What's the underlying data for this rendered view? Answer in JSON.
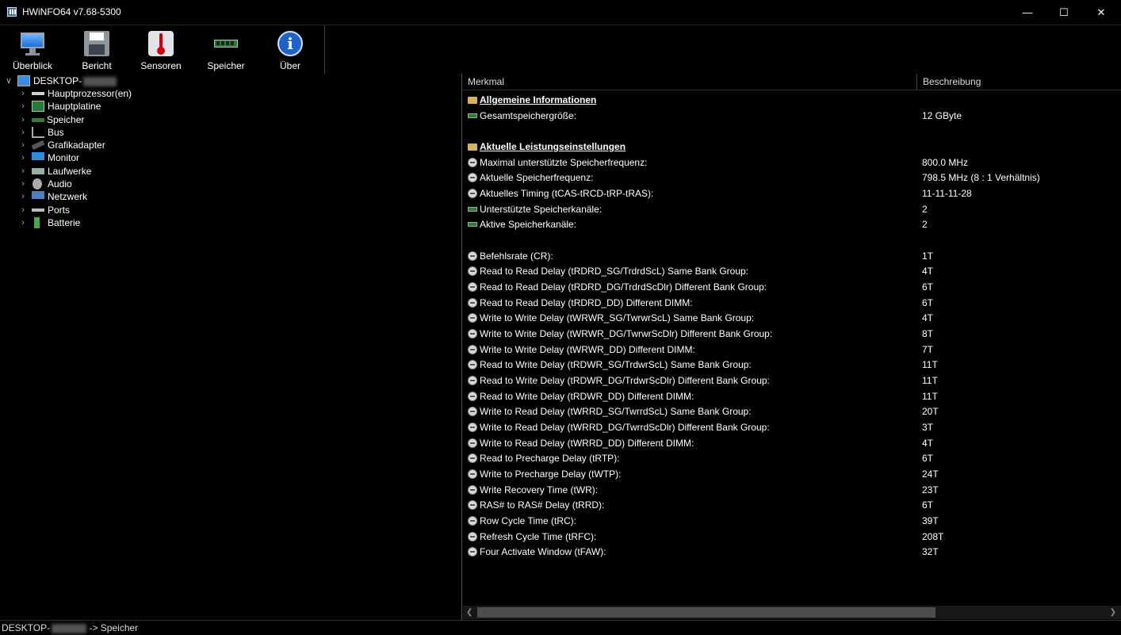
{
  "window": {
    "title": "HWiNFO64 v7.68-5300"
  },
  "toolbar": [
    {
      "label": "Überblick",
      "icon": "monitor-icon"
    },
    {
      "label": "Bericht",
      "icon": "floppy-disk-icon"
    },
    {
      "label": "Sensoren",
      "icon": "thermometer-icon"
    },
    {
      "label": "Speicher",
      "icon": "memory-module-icon"
    },
    {
      "label": "Über",
      "icon": "info-icon"
    }
  ],
  "tree": {
    "root": "DESKTOP-",
    "items": [
      {
        "label": "Hauptprozessor(en)",
        "icon": "cpu-icon"
      },
      {
        "label": "Hauptplatine",
        "icon": "motherboard-icon"
      },
      {
        "label": "Speicher",
        "icon": "memory-icon",
        "selected": true
      },
      {
        "label": "Bus",
        "icon": "bus-icon"
      },
      {
        "label": "Grafikadapter",
        "icon": "gpu-icon"
      },
      {
        "label": "Monitor",
        "icon": "monitor-icon"
      },
      {
        "label": "Laufwerke",
        "icon": "drive-icon"
      },
      {
        "label": "Audio",
        "icon": "audio-icon"
      },
      {
        "label": "Netzwerk",
        "icon": "network-icon"
      },
      {
        "label": "Ports",
        "icon": "ports-icon"
      },
      {
        "label": "Batterie",
        "icon": "battery-icon"
      }
    ]
  },
  "details": {
    "columns": {
      "merkmal": "Merkmal",
      "beschreibung": "Beschreibung"
    },
    "rows": [
      {
        "type": "section",
        "label": "Allgemeine Informationen",
        "value": ""
      },
      {
        "type": "ram",
        "label": "Gesamtspeichergröße:",
        "value": "12 GByte"
      },
      {
        "type": "section",
        "label": "Aktuelle Leistungseinstellungen",
        "value": ""
      },
      {
        "type": "circle",
        "label": "Maximal unterstützte Speicherfrequenz:",
        "value": "800.0 MHz"
      },
      {
        "type": "circle",
        "label": "Aktuelle Speicherfrequenz:",
        "value": "798.5 MHz (8 : 1 Verhältnis)"
      },
      {
        "type": "circle",
        "label": "Aktuelles Timing (tCAS-tRCD-tRP-tRAS):",
        "value": "11-11-11-28"
      },
      {
        "type": "ram",
        "label": "Unterstützte Speicherkanäle:",
        "value": "2"
      },
      {
        "type": "ram",
        "label": "Aktive Speicherkanäle:",
        "value": "2"
      },
      {
        "type": "circle",
        "label": "Befehlsrate (CR):",
        "value": "1T"
      },
      {
        "type": "circle",
        "label": "Read to Read Delay (tRDRD_SG/TrdrdScL) Same Bank Group:",
        "value": "4T"
      },
      {
        "type": "circle",
        "label": "Read to Read Delay (tRDRD_DG/TrdrdScDlr) Different Bank Group:",
        "value": "6T"
      },
      {
        "type": "circle",
        "label": "Read to Read Delay (tRDRD_DD) Different DIMM:",
        "value": "6T"
      },
      {
        "type": "circle",
        "label": "Write to Write Delay (tWRWR_SG/TwrwrScL) Same Bank Group:",
        "value": "4T"
      },
      {
        "type": "circle",
        "label": "Write to Write Delay (tWRWR_DG/TwrwrScDlr) Different Bank Group:",
        "value": "8T"
      },
      {
        "type": "circle",
        "label": "Write to Write Delay (tWRWR_DD) Different DIMM:",
        "value": "7T"
      },
      {
        "type": "circle",
        "label": "Read to Write Delay (tRDWR_SG/TrdwrScL) Same Bank Group:",
        "value": "11T"
      },
      {
        "type": "circle",
        "label": "Read to Write Delay (tRDWR_DG/TrdwrScDlr) Different Bank Group:",
        "value": "11T"
      },
      {
        "type": "circle",
        "label": "Read to Write Delay (tRDWR_DD) Different DIMM:",
        "value": "11T"
      },
      {
        "type": "circle",
        "label": "Write to Read Delay (tWRRD_SG/TwrrdScL) Same Bank Group:",
        "value": "20T"
      },
      {
        "type": "circle",
        "label": "Write to Read Delay (tWRRD_DG/TwrrdScDlr) Different Bank Group:",
        "value": "3T"
      },
      {
        "type": "circle",
        "label": "Write to Read Delay (tWRRD_DD) Different DIMM:",
        "value": "4T"
      },
      {
        "type": "circle",
        "label": "Read to Precharge Delay (tRTP):",
        "value": "6T"
      },
      {
        "type": "circle",
        "label": "Write to Precharge Delay (tWTP):",
        "value": "24T"
      },
      {
        "type": "circle",
        "label": "Write Recovery Time (tWR):",
        "value": "23T"
      },
      {
        "type": "circle",
        "label": "RAS# to RAS# Delay (tRRD):",
        "value": "6T"
      },
      {
        "type": "circle",
        "label": "Row Cycle Time (tRC):",
        "value": "39T"
      },
      {
        "type": "circle",
        "label": "Refresh Cycle Time (tRFC):",
        "value": "208T"
      },
      {
        "type": "circle",
        "label": "Four Activate Window (tFAW):",
        "value": "32T"
      }
    ]
  },
  "statusbar": {
    "prefix": "DESKTOP-",
    "suffix": " -> Speicher"
  }
}
